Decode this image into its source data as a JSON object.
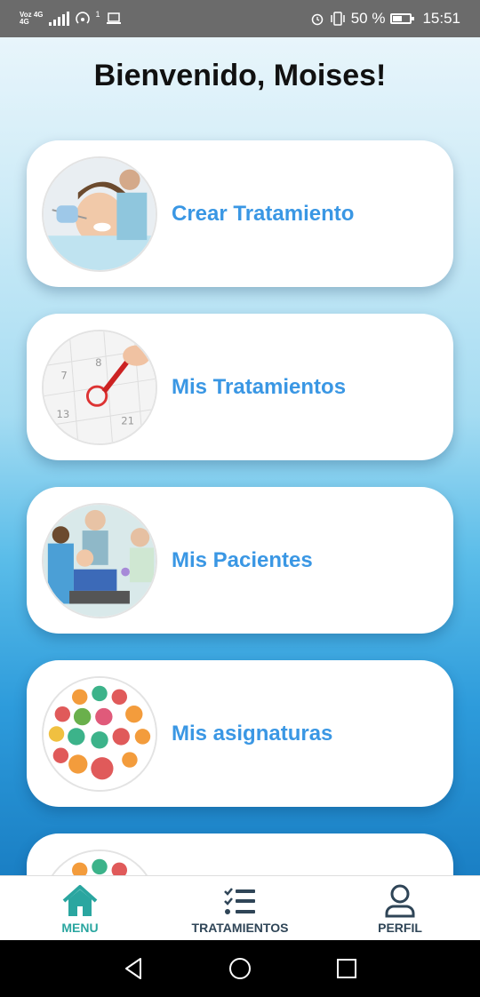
{
  "status_bar": {
    "network_top": "Voz 4G",
    "network_bottom": "4G",
    "notification_count": "1",
    "battery_percent": "50 %",
    "time": "15:51"
  },
  "page": {
    "title": "Bienvenido, Moises!"
  },
  "cards": [
    {
      "label": "Crear Tratamiento",
      "icon": "dentist-photo"
    },
    {
      "label": "Mis Tratamientos",
      "icon": "calendar-photo"
    },
    {
      "label": "Mis Pacientes",
      "icon": "patients-photo"
    },
    {
      "label": "Mis asignaturas",
      "icon": "subjects-photo"
    },
    {
      "label": "",
      "icon": "subjects-photo"
    }
  ],
  "bottom_nav": {
    "items": [
      {
        "label": "MENU",
        "icon": "home-icon",
        "active": true
      },
      {
        "label": "TRATAMIENTOS",
        "icon": "checklist-icon",
        "active": false
      },
      {
        "label": "PERFIL",
        "icon": "user-icon",
        "active": false
      }
    ]
  },
  "colors": {
    "accent": "#3a97e4",
    "active_nav": "#2aa6a0",
    "inactive_nav": "#2f4557"
  }
}
